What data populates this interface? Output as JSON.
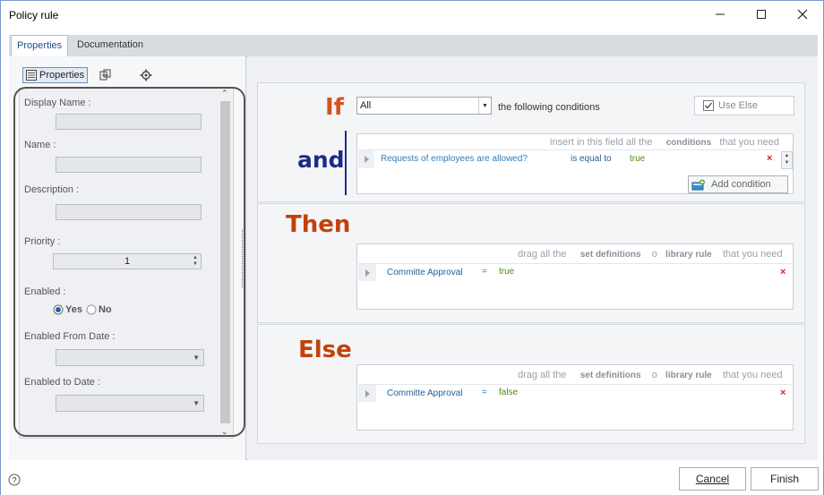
{
  "window": {
    "title": "Policy rule",
    "minimize_icon": "minimize-icon",
    "maximize_icon": "maximize-icon",
    "close_icon": "close-icon"
  },
  "tabs": [
    {
      "label": "Properties",
      "active": true
    },
    {
      "label": "Documentation",
      "active": false
    }
  ],
  "left_toolbar": {
    "properties_label": "Properties",
    "icons": [
      "properties-grid-icon",
      "layout-icon",
      "gear-icon"
    ]
  },
  "properties": {
    "display_name_label": "Display Name :",
    "display_name_value": "",
    "name_label": "Name :",
    "name_value": "",
    "description_label": "Description :",
    "description_value": "",
    "priority_label": "Priority :",
    "priority_value": "1",
    "enabled_label": "Enabled :",
    "enabled_yes": "Yes",
    "enabled_no": "No",
    "enabled_selected": "Yes",
    "enabled_from_label": "Enabled From Date :",
    "enabled_from_value": "",
    "enabled_to_label": "Enabled to Date :",
    "enabled_to_value": ""
  },
  "if_section": {
    "if_word": "If",
    "and_word": "and",
    "quantifier_value": "All",
    "following_text": "the following conditions",
    "use_else_label": "Use Else",
    "use_else_checked": true,
    "hint_prefix": "insert in this field all the",
    "hint_bold": "conditions",
    "hint_suffix": "that you need",
    "condition": {
      "subject": "Requests of employees are allowed?",
      "operator": "is equal to",
      "value": "true"
    },
    "add_condition_label": "Add condition"
  },
  "then_section": {
    "word": "Then",
    "hint_prefix": "drag all the",
    "hint_bold1": "set definitions",
    "hint_or": "o",
    "hint_bold2": "library rule",
    "hint_suffix": "that you need",
    "assignment": {
      "target": "Committe Approval",
      "eq": "=",
      "value": "true"
    }
  },
  "else_section": {
    "word": "Else",
    "hint_prefix": "drag all the",
    "hint_bold1": "set definitions",
    "hint_or": "o",
    "hint_bold2": "library rule",
    "hint_suffix": "that you need",
    "assignment": {
      "target": "Committe Approval",
      "eq": "=",
      "value": "false"
    }
  },
  "footer": {
    "help_icon": "help-icon",
    "cancel_label": "Cancel",
    "finish_label": "Finish"
  },
  "colors": {
    "if_word": "#d2541b",
    "and_word": "#1c2a8a",
    "then_word": "#c2410c",
    "else_word": "#c2410c"
  }
}
